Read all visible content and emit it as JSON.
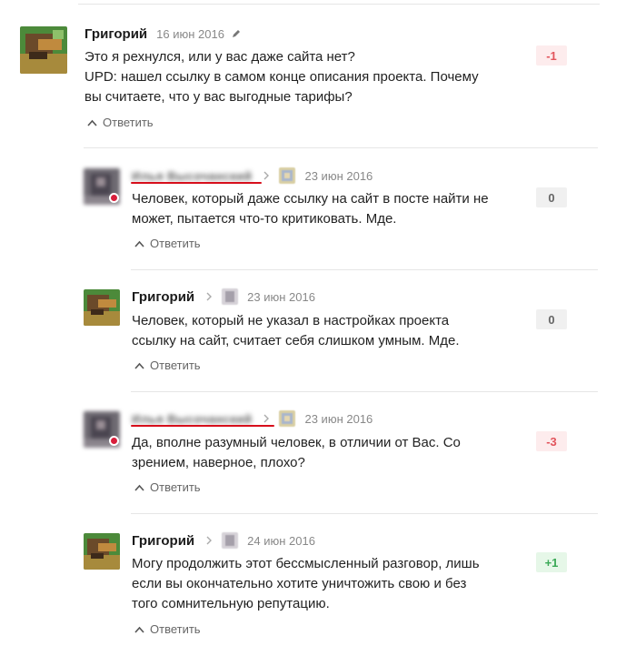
{
  "comments": [
    {
      "author": "Григорий",
      "date": "16 июн 2016",
      "edited": true,
      "text_lines": [
        "Это я рехнулся, или у вас даже сайта нет?",
        "UPD: нашел ссылку в самом конце описания проекта. Почему",
        "вы считаете, что у вас выгодные тарифы?"
      ],
      "reply_label": "Ответить",
      "score": "-1"
    },
    {
      "author": "Илья Высочанский",
      "author_blurred": true,
      "date": "23 июн 2016",
      "text_lines": [
        "Человек, который даже ссылку на сайт в посте найти не",
        "может, пытается что-то критиковать. Мде."
      ],
      "reply_label": "Ответить",
      "score": "0"
    },
    {
      "author": "Григорий",
      "date": "23 июн 2016",
      "text_lines": [
        "Человек, который не указал в настройках проекта",
        "ссылку на сайт, считает себя слишком умным. Мде."
      ],
      "reply_label": "Ответить",
      "score": "0"
    },
    {
      "author": "Илья Высочанский",
      "author_blurred": true,
      "date": "23 июн 2016",
      "text_lines": [
        "Да, вполне разумный человек, в отличии от Вас. Со",
        "зрением, наверное, плохо?"
      ],
      "reply_label": "Ответить",
      "score": "-3"
    },
    {
      "author": "Григорий",
      "date": "24 июн 2016",
      "text_lines": [
        "Могу продолжить этот бессмысленный разговор, лишь",
        "если вы окончательно хотите уничтожить свою и без",
        "того сомнительную репутацию."
      ],
      "reply_label": "Ответить",
      "score": "+1"
    }
  ],
  "colors": {
    "negative_text": "#e2545c",
    "negative_bg": "#fdeced",
    "neutral_text": "#666666",
    "neutral_bg": "#f0f0f0",
    "positive_text": "#3aa956",
    "positive_bg": "#e6f7e8",
    "annotation_underline": "#d70f1c"
  },
  "icons": {
    "edit": "pencil-icon",
    "reply": "chevron-up-icon",
    "reply_to": "chevron-right-icon"
  }
}
